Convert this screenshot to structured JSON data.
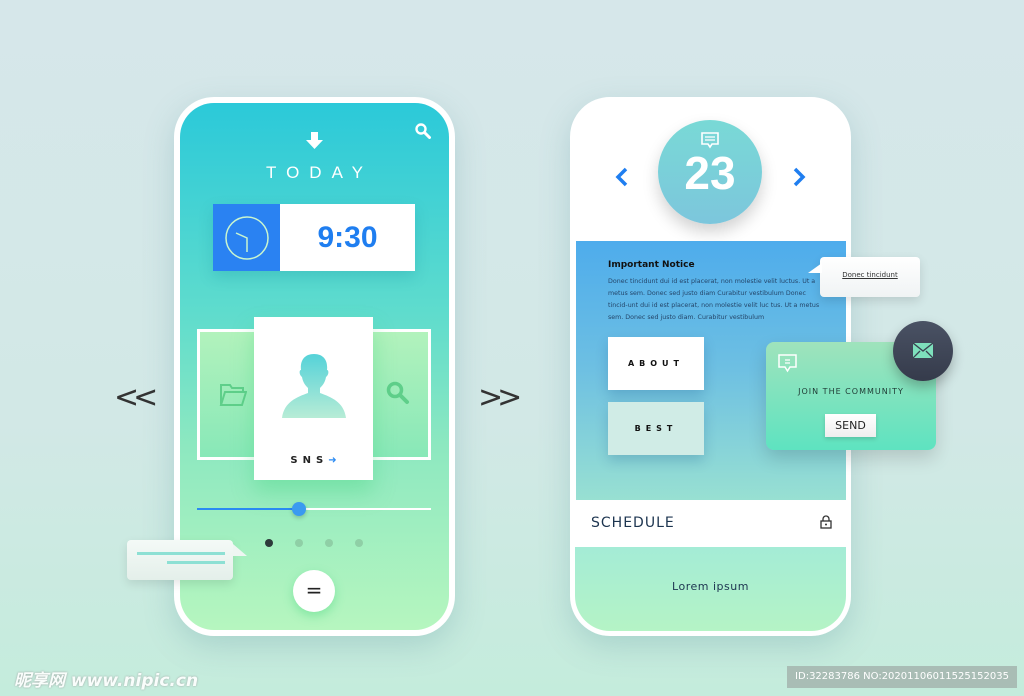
{
  "nav": {
    "prev": "<<",
    "next": ">>"
  },
  "left_phone": {
    "title": "TODAY",
    "time": "9:30",
    "card_label": "SNS",
    "slider_value_percent": 44,
    "pager": {
      "count": 4,
      "active": 0
    },
    "icons": [
      "download-arrow-icon",
      "search-icon",
      "clock-icon",
      "folder-icon",
      "user-icon",
      "arrow-right-icon",
      "chat-bubble-icon",
      "menu-equal-icon"
    ]
  },
  "right_phone": {
    "date": "23",
    "notice": {
      "title": "Important Notice",
      "body": "Donec tincidunt dui id est placerat, non molestie velit luctus. Ut a metus sem. Donec sed justo diam Curabitur vestibulum Donec tincid-unt dui id est placerat, non molestie velit luc tus. Ut a metus sem. Donec sed justo diam. Curabitur vestibulum"
    },
    "buttons": {
      "about": "ABOUT",
      "best": "BEST"
    },
    "schedule": "SCHEDULE",
    "footer": "Lorem ipsum",
    "tooltip": "Donec tincidunt",
    "community": {
      "title": "JOIN THE COMMUNITY",
      "send": "SEND"
    }
  },
  "watermark": {
    "logo": "昵享网 www.nipic.cn",
    "id": "ID:32283786 NO:20201106011525152035"
  },
  "colors": {
    "accent_blue": "#1f7ef0",
    "teal": "#2bc9d9",
    "green": "#b6f6bf",
    "dark": "#3a4150"
  }
}
